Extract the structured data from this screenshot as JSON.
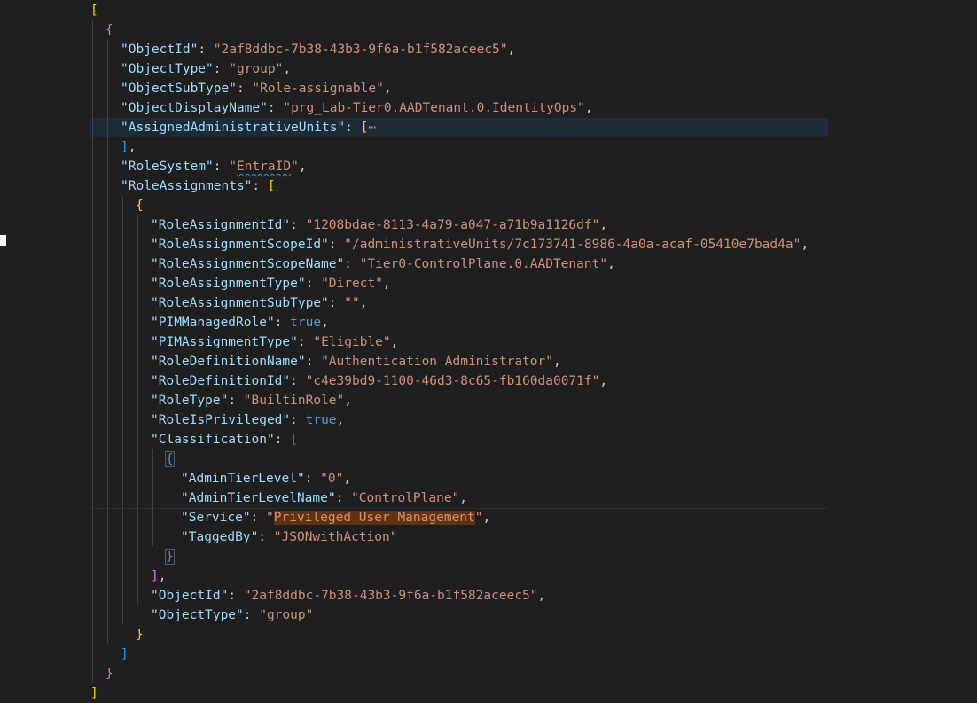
{
  "editor": {
    "lines": [
      "[",
      "{",
      "\"ObjectId\": \"2af8ddbc-7b38-43b3-9f6a-b1f582aceec5\",",
      "\"ObjectType\": \"group\",",
      "\"ObjectSubType\": \"Role-assignable\",",
      "\"ObjectDisplayName\": \"prg_Lab-Tier0.AADTenant.0.IdentityOps\",",
      "\"AssignedAdministrativeUnits\": [⋯",
      "],",
      "\"RoleSystem\": \"EntraID\",",
      "\"RoleAssignments\": [",
      "{",
      "\"RoleAssignmentId\": \"1208bdae-8113-4a79-a047-a71b9a1126df\",",
      "\"RoleAssignmentScopeId\": \"/administrativeUnits/7c173741-8986-4a0a-acaf-05410e7bad4a\",",
      "\"RoleAssignmentScopeName\": \"Tier0-ControlPlane.0.AADTenant\",",
      "\"RoleAssignmentType\": \"Direct\",",
      "\"RoleAssignmentSubType\": \"\",",
      "\"PIMManagedRole\": true,",
      "\"PIMAssignmentType\": \"Eligible\",",
      "\"RoleDefinitionName\": \"Authentication Administrator\",",
      "\"RoleDefinitionId\": \"c4e39bd9-1100-46d3-8c65-fb160da0071f\",",
      "\"RoleType\": \"BuiltinRole\",",
      "\"RoleIsPrivileged\": true,",
      "\"Classification\": [",
      "{",
      "\"AdminTierLevel\": \"0\",",
      "\"AdminTierLevelName\": \"ControlPlane\",",
      "\"Service\": \"Privileged User Management\",",
      "\"TaggedBy\": \"JSONwithAction\"",
      "}",
      "],",
      "\"ObjectId\": \"2af8ddbc-7b38-43b3-9f6a-b1f582aceec5\",",
      "\"ObjectType\": \"group\"",
      "}",
      "]",
      "}",
      "]"
    ]
  },
  "colors": {
    "background": "#1f1f1f",
    "key": "#9cdcfe",
    "string": "#ce9178",
    "boolean": "#569cd6",
    "bracket_level1": "#ffd700",
    "bracket_level2": "#da70d6",
    "bracket_level3": "#179fff",
    "selection_highlight": "#613214"
  }
}
